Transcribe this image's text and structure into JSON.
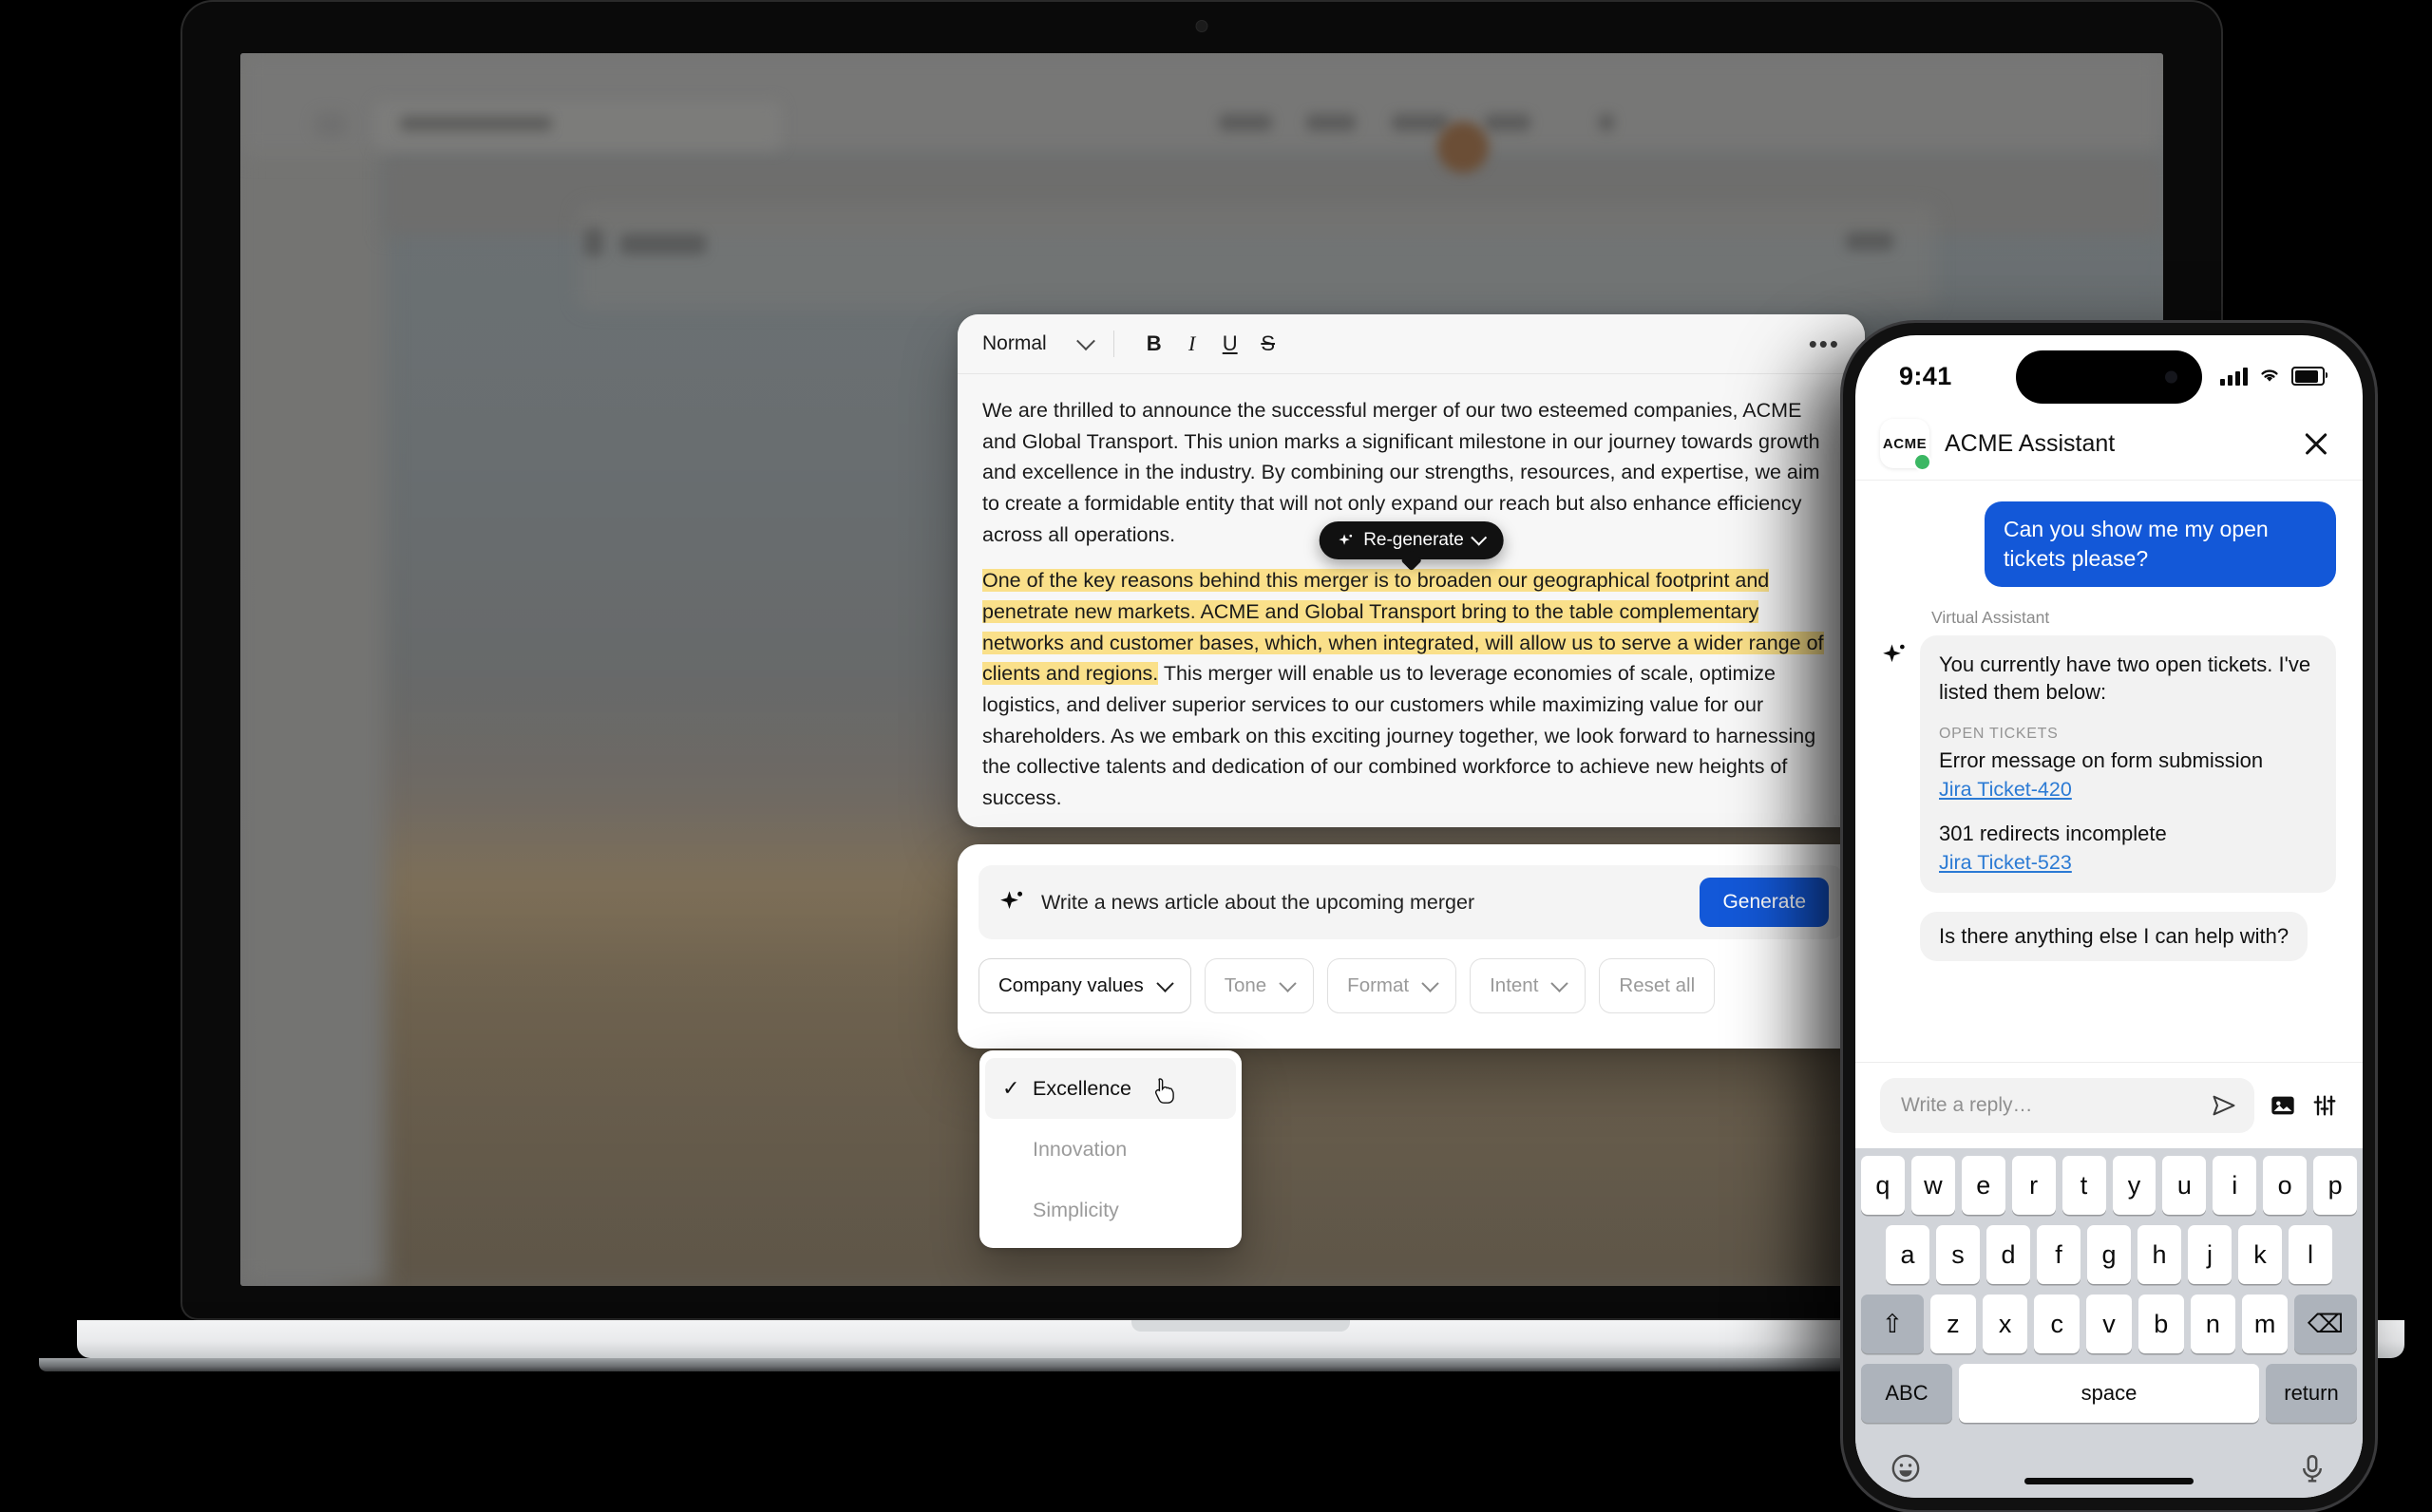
{
  "colors": {
    "accent_blue": "#1358d8",
    "highlight_yellow": "#fae08a",
    "link_blue": "#2b7ad4",
    "online_green": "#3bb763",
    "dark_pill": "#111111"
  },
  "laptop": {
    "editor": {
      "toolbar": {
        "style_label": "Normal",
        "bold_label": "B",
        "italic_label": "I",
        "underline_label": "U",
        "strikethrough_label": "S",
        "more_label": "•••"
      },
      "paragraph_1": "We are thrilled to announce the successful merger of our two esteemed companies, ACME and Global Transport. This union marks a significant milestone in our journey towards growth and excellence in the industry. By combining our strengths, resources, and expertise, we aim to create a formidable entity that will not only expand our reach but also enhance efficiency across all operations.",
      "paragraph_2_highlighted": "One of the key reasons behind this merger is to broaden our geographical footprint and penetrate new markets. ACME and Global Transport bring to the table complementary networks and customer bases, which, when integrated, will allow us to serve a wider range of clients and regions.",
      "paragraph_2_rest": " This merger will enable us to leverage economies of scale, optimize logistics, and deliver superior services to our customers while maximizing value for our shareholders. As we embark on this exciting journey together, we look forward to harnessing the collective talents and dedication of our combined workforce to achieve new heights of success.",
      "regenerate_label": "Re-generate"
    },
    "prompt": {
      "text": "Write a news article about the upcoming merger",
      "generate_label": "Generate",
      "chips": [
        {
          "label": "Company values",
          "has_chevron": true,
          "active": true
        },
        {
          "label": "Tone",
          "has_chevron": true,
          "active": false
        },
        {
          "label": "Format",
          "has_chevron": true,
          "active": false
        },
        {
          "label": "Intent",
          "has_chevron": true,
          "active": false
        },
        {
          "label": "Reset all",
          "has_chevron": false,
          "active": false
        }
      ]
    },
    "dropdown": {
      "items": [
        {
          "label": "Excellence",
          "selected": true
        },
        {
          "label": "Innovation",
          "selected": false
        },
        {
          "label": "Simplicity",
          "selected": false
        }
      ],
      "check_glyph": "✓"
    }
  },
  "phone": {
    "status_bar": {
      "time": "9:41"
    },
    "header": {
      "brand_badge": "ACME",
      "title": "ACME Assistant"
    },
    "chat": {
      "user_message": "Can you show me my open tickets please?",
      "assistant_sender": "Virtual Assistant",
      "assistant_intro": "You currently have two open tickets. I've listed them below:",
      "tickets_label": "OPEN TICKETS",
      "tickets": [
        {
          "title": "Error message on form submission",
          "link": "Jira Ticket-420"
        },
        {
          "title": "301 redirects incomplete",
          "link": "Jira Ticket-523"
        }
      ],
      "assistant_followup": "Is there anything else I can help with?"
    },
    "reply": {
      "placeholder": "Write a reply…"
    },
    "keyboard": {
      "row1": [
        "q",
        "w",
        "e",
        "r",
        "t",
        "y",
        "u",
        "i",
        "o",
        "p"
      ],
      "row2": [
        "a",
        "s",
        "d",
        "f",
        "g",
        "h",
        "j",
        "k",
        "l"
      ],
      "row3": [
        "z",
        "x",
        "c",
        "v",
        "b",
        "n",
        "m"
      ],
      "shift_label": "⇧",
      "backspace_label": "⌫",
      "abc_label": "ABC",
      "space_label": "space",
      "return_label": "return"
    }
  }
}
